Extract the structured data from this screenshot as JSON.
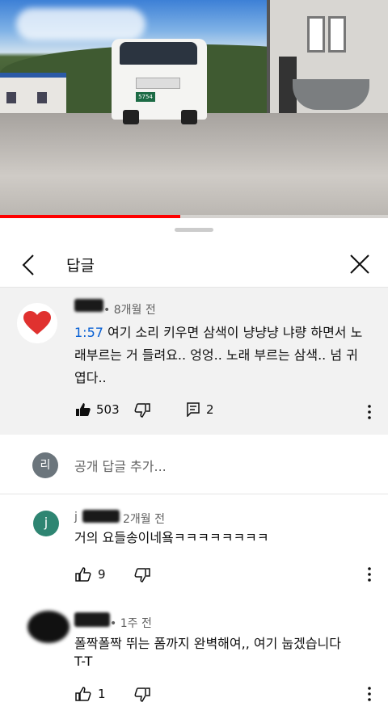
{
  "video": {
    "plate_text": "5754",
    "progress_fraction": 0.465
  },
  "sheet": {
    "title": "답글",
    "icons": {
      "back": "chevron-left-icon",
      "close": "close-icon"
    }
  },
  "parent_comment": {
    "avatar": "heart-icon",
    "time_ago": "• 8개월 전",
    "timestamp": "1:57",
    "text_line1": "여기 소리 키우면 삼색이 냥냥냥 냐량 하면서 노",
    "text_line2": "래부르는 거 들려요.. 엉엉.. 노래 부르는 삼색.. 넘 귀",
    "text_line3": "엽다..",
    "likes": "503",
    "replies": "2"
  },
  "reply_box": {
    "avatar_letter": "리",
    "placeholder": "공개 답글 추가..."
  },
  "replies": [
    {
      "avatar_letter": "j",
      "name_visible": "j",
      "time_ago": "2개월 전",
      "text": "거의 요들송이네욬ㅋㅋㅋㅋㅋㅋㅋㅋ",
      "likes": "9"
    },
    {
      "time_ago": "• 1주 전",
      "text_line1": "폴짝폴짝 뛰는 폼까지 완벽해여,, 여기 눕겠습니다",
      "text_line2": "T-T",
      "likes": "1"
    }
  ],
  "colors": {
    "accent_link": "#065fd4",
    "progress": "#ff0000",
    "heart": "#e0312f",
    "avatar_j": "#2e8572",
    "avatar_ri": "#6b757c"
  }
}
